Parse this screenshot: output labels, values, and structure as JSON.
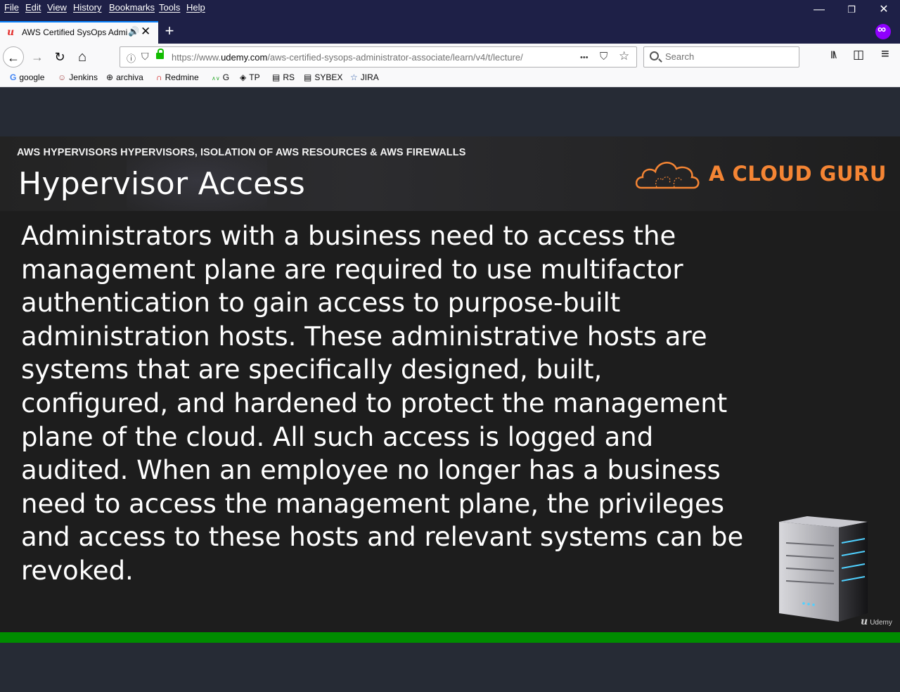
{
  "menu": [
    "File",
    "Edit",
    "View",
    "History",
    "Bookmarks",
    "Tools",
    "Help"
  ],
  "window_controls": {
    "minimize": "—",
    "restore": "❐",
    "close": "✕"
  },
  "tab": {
    "title": "AWS Certified SysOps Administrator",
    "favicon": "udemy-logo-icon",
    "audio": "🔊",
    "close": "✕"
  },
  "newtab": "+",
  "nav": {
    "back": "←",
    "forward": "→",
    "reload": "↻",
    "home": "⌂"
  },
  "url": {
    "prefix": "https://www.",
    "host": "udemy.com",
    "path": "/aws-certified-sysops-administrator-associate/learn/v4/t/lecture/",
    "more": "•••",
    "pocket": "⛉",
    "star": "☆"
  },
  "search": {
    "placeholder": "Search"
  },
  "toolbar": {
    "library": "Ⅱ\\",
    "sidebar": "◫",
    "menu": "≡"
  },
  "bookmarks": [
    {
      "label": "google",
      "icon": "G"
    },
    {
      "label": "Jenkins",
      "icon": "☺"
    },
    {
      "label": "archiva",
      "icon": "⊕"
    },
    {
      "label": "Redmine",
      "icon": "∩"
    },
    {
      "label": "G",
      "icon": "∧∨"
    },
    {
      "label": "TP",
      "icon": "◈"
    },
    {
      "label": "RS",
      "icon": "▤"
    },
    {
      "label": "SYBEX",
      "icon": "▤"
    },
    {
      "label": "JIRA",
      "icon": "☆"
    }
  ],
  "slide": {
    "topic": "AWS HYPERVISORS HYPERVISORS, ISOLATION OF AWS RESOURCES & AWS FIREWALLS",
    "title": "Hypervisor Access",
    "brand": "A CLOUD GURU",
    "body": "Administrators with a business need to access the management plane are required to use multifactor authentication to gain access to purpose-built administration hosts. These administrative hosts are systems that are specifically designed, built, configured, and hardened to protect the management plane of the cloud. All such access is logged and audited. When an employee no longer has a business need to access the management plane, the privileges and access to these hosts and relevant systems can be revoked.",
    "watermark": "Udemy",
    "brand_color": "#f58534"
  },
  "progress": {
    "fraction": 1.0,
    "color": "#008c00"
  }
}
